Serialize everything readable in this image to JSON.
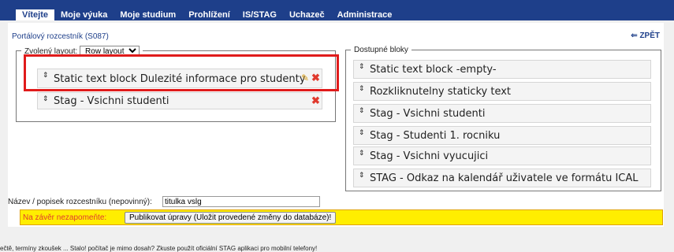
{
  "nav": {
    "tabs": [
      "Vítejte",
      "Moje výuka",
      "Moje studium",
      "Prohlížení",
      "IS/STAG",
      "Uchazeč",
      "Administrace"
    ]
  },
  "page": {
    "title": "Portálový rozcestník (S087)",
    "back_label": "⇐ ZPĚT"
  },
  "chosen": {
    "legend_label": "Zvolený layout:",
    "layout_value": "Row layout",
    "blocks": [
      "Static text block Dulezité informace pro studenty",
      "Stag - Vsichni studenti"
    ]
  },
  "available": {
    "legend": "Dostupné bloky",
    "blocks": [
      "Static text block -empty-",
      "Rozkliknutelny staticky text",
      "Stag - Vsichni studenti",
      "Stag - Studenti 1. rocniku",
      "Stag - Vsichni vyucujici",
      "STAG - Odkaz na kalendář uživatele ve formátu ICAL"
    ]
  },
  "form": {
    "name_label": "Název / popisek rozcestníku (nepovinný):",
    "name_value": "titulka vslg",
    "warning": "Na závěr nezapomeňte:",
    "publish_label": "Publikovat úpravy (Uložit provedené změny do databáze)!"
  },
  "footer": {
    "text": "ečtě, termíny zkoušek ... Stalo! počítač je mimo dosah? Zkuste použít oficiální STAG aplikaci pro mobilní telefony!"
  },
  "colors": {
    "nav_bg": "#1e3f8a",
    "highlight": "#e01b1b",
    "warning_bg": "#ffee00",
    "delete": "#e03a2e"
  },
  "icons": {
    "grip": "drag-handle-icon",
    "edit": "pencil-icon",
    "delete": "close-icon",
    "back": "arrow-left-icon"
  }
}
